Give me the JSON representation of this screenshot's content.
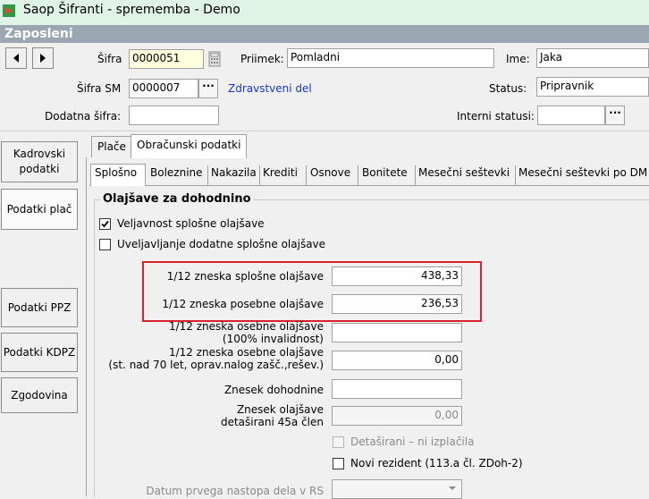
{
  "window": {
    "title": "Saop Šifranti - sprememba - Demo"
  },
  "header": {
    "title": "Zaposleni"
  },
  "form": {
    "sifra_label": "Šifra",
    "sifra_value": "0000051",
    "priimek_label": "Priimek:",
    "priimek_value": "Pomladni",
    "ime_label": "Ime:",
    "ime_value": "Jaka",
    "sifra_sm_label": "Šifra SM",
    "sifra_sm_value": "0000007",
    "sifra_sm_desc": "Zdravstveni del",
    "status_label": "Status:",
    "status_value": "Pripravnik",
    "dodatna_label": "Dodatna šifra:",
    "dodatna_value": "",
    "interni_label": "Interni statusi:",
    "interni_value": "",
    "ellipsis": "···"
  },
  "sidebar": {
    "items": [
      {
        "label": "Kadrovski podatki"
      },
      {
        "label": "Podatki plač"
      },
      {
        "label": "Podatki PPZ"
      },
      {
        "label": "Podatki KDPZ"
      },
      {
        "label": "Zgodovina"
      }
    ]
  },
  "tabs": [
    {
      "label": "Plače"
    },
    {
      "label": "Obračunski podatki"
    }
  ],
  "subtabs": [
    {
      "label": "Splošno"
    },
    {
      "label": "Boleznine"
    },
    {
      "label": "Nakazila"
    },
    {
      "label": "Krediti"
    },
    {
      "label": "Osnove"
    },
    {
      "label": "Bonitete"
    },
    {
      "label": "Mesečni seštevki"
    },
    {
      "label": "Mesečni seštevki po DM"
    }
  ],
  "olajsave": {
    "title": "Olajšave za dohodnino",
    "veljavnost_label": "Veljavnost splošne olajšave",
    "veljavnost_checked": true,
    "uveljavljanje_label": "Uveljavljanje dodatne splošne olajšave",
    "uveljavljanje_checked": false,
    "splosna_label": "1/12 zneska splošne olajšave",
    "splosna_value": "438,33",
    "posebna_label": "1/12 zneska posebne olajšave",
    "posebna_value": "236,53",
    "osebna100_label1": "1/12 zneska osebne olajšave",
    "osebna100_label2": "(100% invalidnost)",
    "osebna100_value": "",
    "osebna70_label1": "1/12 zneska osebne olajšave",
    "osebna70_label2": "(st. nad 70 let, oprav.nalog zašč.,rešev.)",
    "osebna70_value": "0,00",
    "znesek_dohodnine_label": "Znesek dohodnine",
    "znesek_dohodnine_value": "",
    "detasirani_label1": "Znesek olajšave",
    "detasirani_label2": "detaširani 45a člen",
    "detasirani_value": "0,00",
    "detasirani_check_label": "Detaširani – ni izplačila",
    "nov_rezident_label": "Novi rezident (113.a čl. ZDoh-2)",
    "datum_label": "Datum prvega nastopa dela v RS",
    "datum_value": ""
  },
  "colors": {
    "highlight": "#d9222a",
    "link": "#1a33cc",
    "header": "#9aa6b2"
  }
}
